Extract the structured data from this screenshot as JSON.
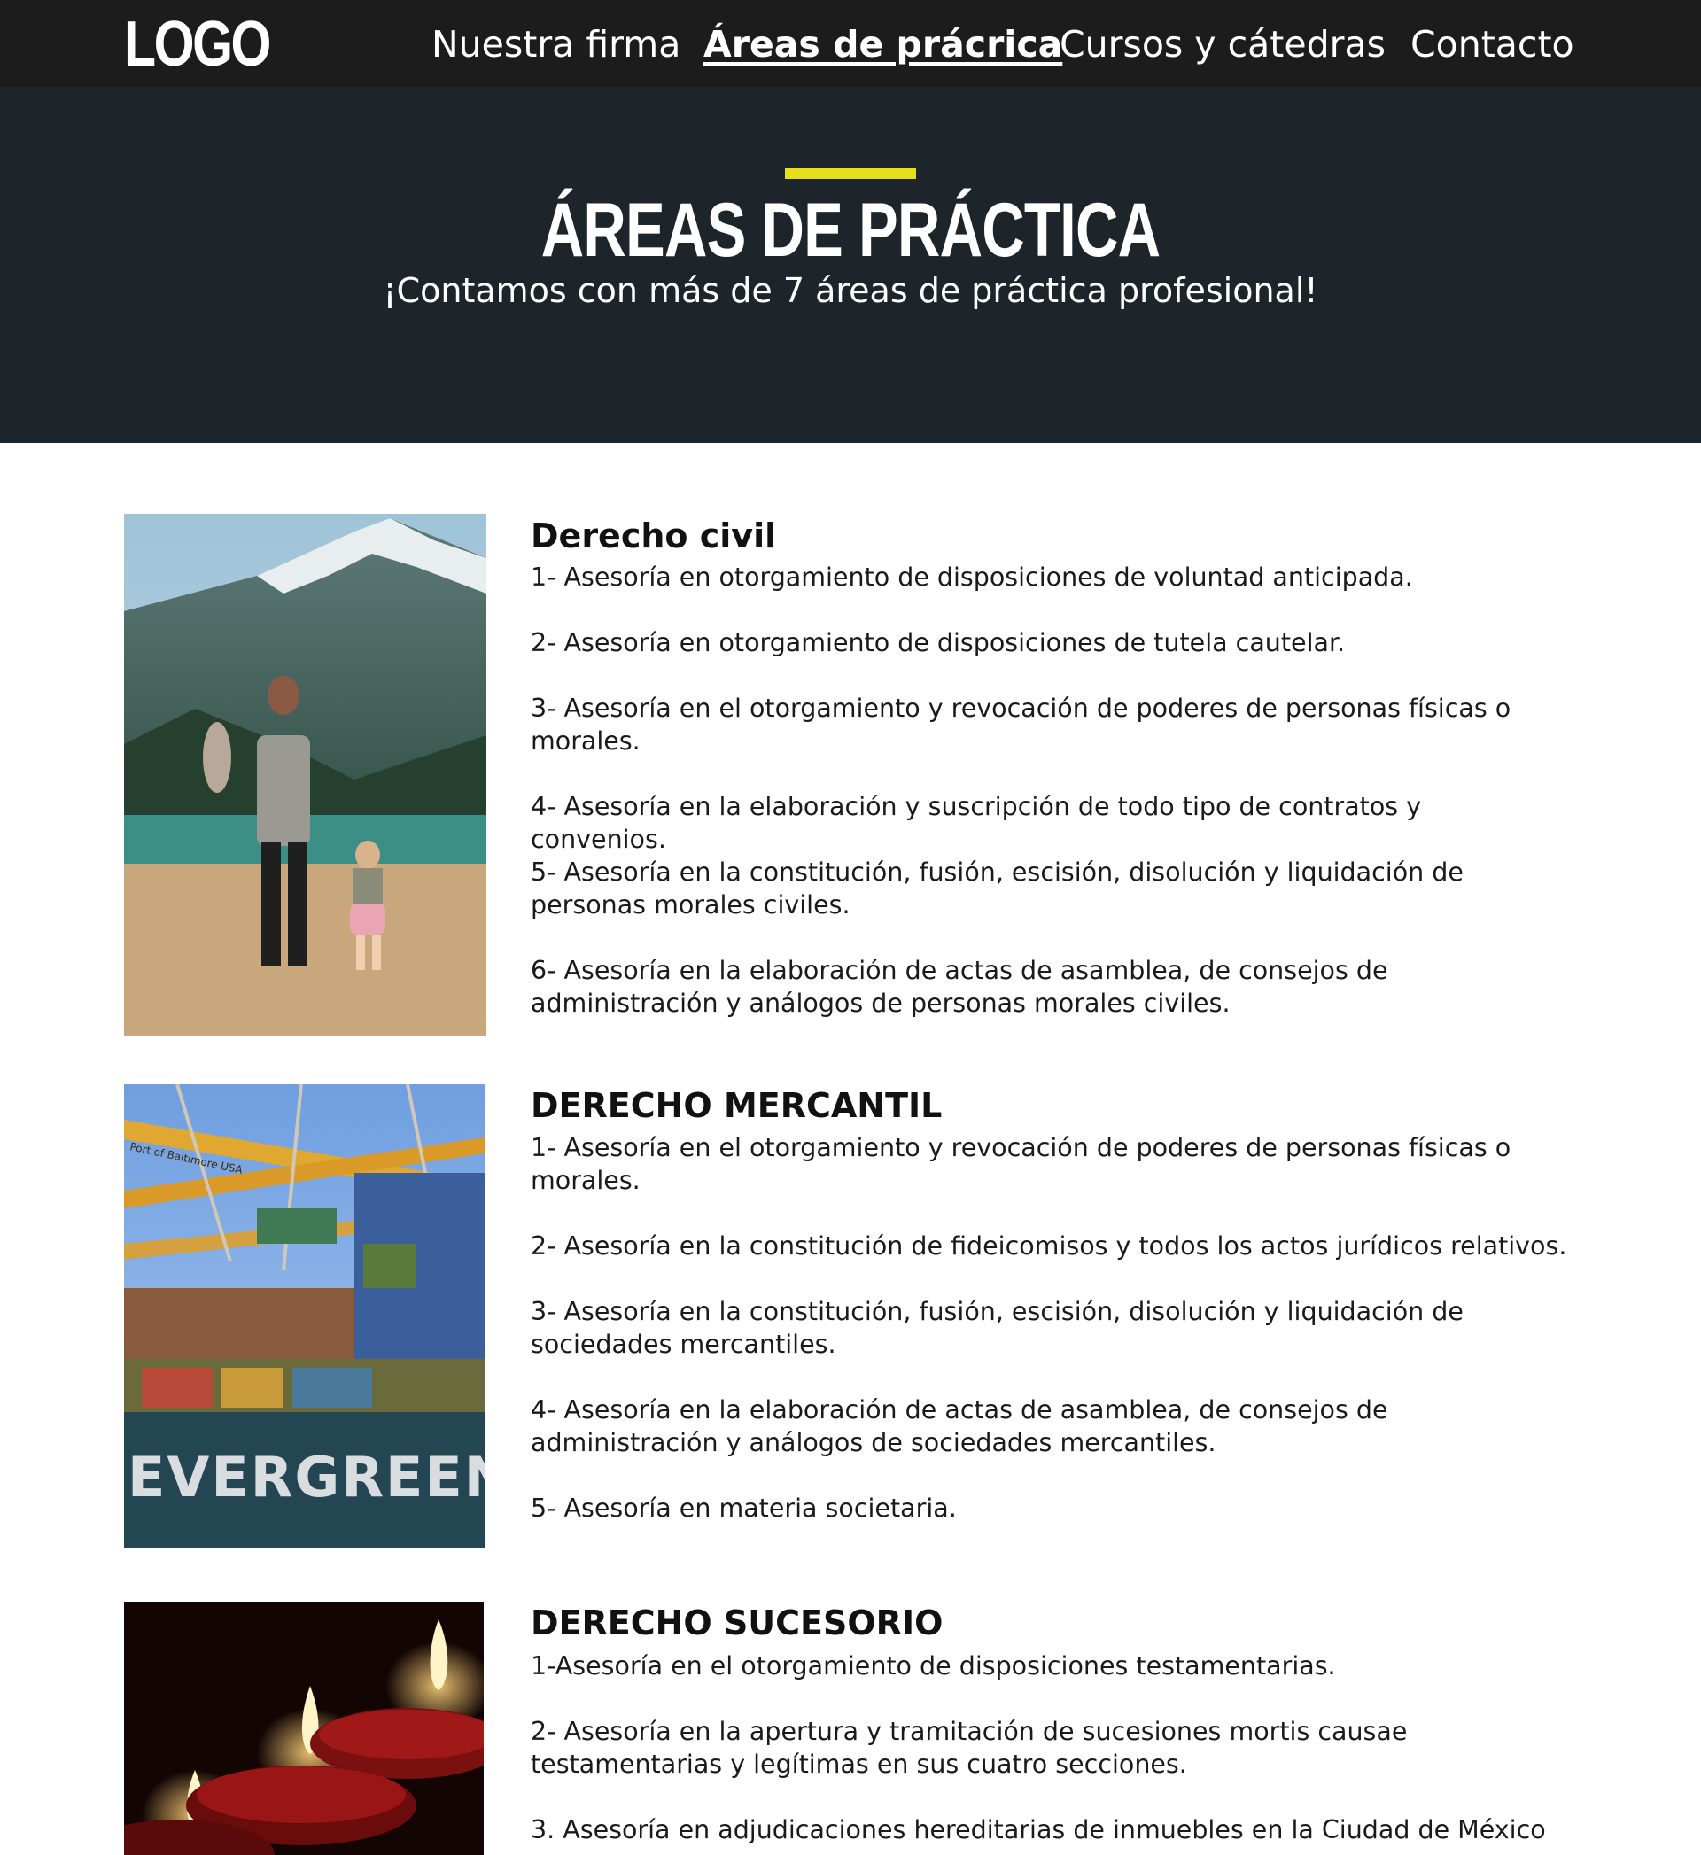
{
  "header": {
    "logo": "LOGO",
    "nav": [
      {
        "label": "Nuestra firma"
      },
      {
        "label": "Áreas de prácrica"
      },
      {
        "label": "Cursos y cátedras"
      },
      {
        "label": "Contacto"
      }
    ]
  },
  "hero": {
    "title": "ÁREAS DE PRÁCTICA",
    "subtitle": "¡Contamos con más de 7 áreas de práctica profesional!",
    "accent_color": "#e5e01b"
  },
  "sections": [
    {
      "title": "Derecho civil",
      "image": "mother-children-mountain-lake-photo",
      "items": [
        "1- Asesoría en otorgamiento de disposiciones de voluntad anticipada.",
        "2- Asesoría en otorgamiento de disposiciones de tutela cautelar.",
        "3- Asesoría en el otorgamiento y revocación de poderes de personas físicas o morales.",
        "4- Asesoría en la elaboración y suscripción de todo tipo de contratos y convenios.",
        "5- Asesoría en la constitución, fusión, escisión, disolución y liquidación de personas morales civiles.",
        "6- Asesoría en la elaboración de actas de asamblea, de consejos de administración y análogos de personas morales civiles."
      ]
    },
    {
      "title": "DERECHO MERCANTIL",
      "image": "container-ship-port-photo",
      "image_text": {
        "ship": "EVERGREEN",
        "crane": "Port of Baltimore USA"
      },
      "items": [
        "1- Asesoría en el otorgamiento y revocación de poderes de personas físicas o morales.",
        "2- Asesoría en la constitución de fideicomisos y todos los actos jurídicos relativos.",
        "3- Asesoría en la constitución, fusión, escisión, disolución y liquidación de sociedades mercantiles.",
        "4- Asesoría en la elaboración de actas de asamblea, de consejos de administración y análogos de sociedades mercantiles.",
        "5- Asesoría en materia societaria."
      ]
    },
    {
      "title": "DERECHO SUCESORIO",
      "image": "candles-photo",
      "items": [
        "1-Asesoría en el otorgamiento de disposiciones testamentarias.",
        "2- Asesoría en la apertura y tramitación de sucesiones mortis causae testamentarias y legítimas en sus cuatro secciones.",
        "3. Asesoría en adjudicaciones hereditarias de inmuebles en la Ciudad de México"
      ]
    }
  ]
}
